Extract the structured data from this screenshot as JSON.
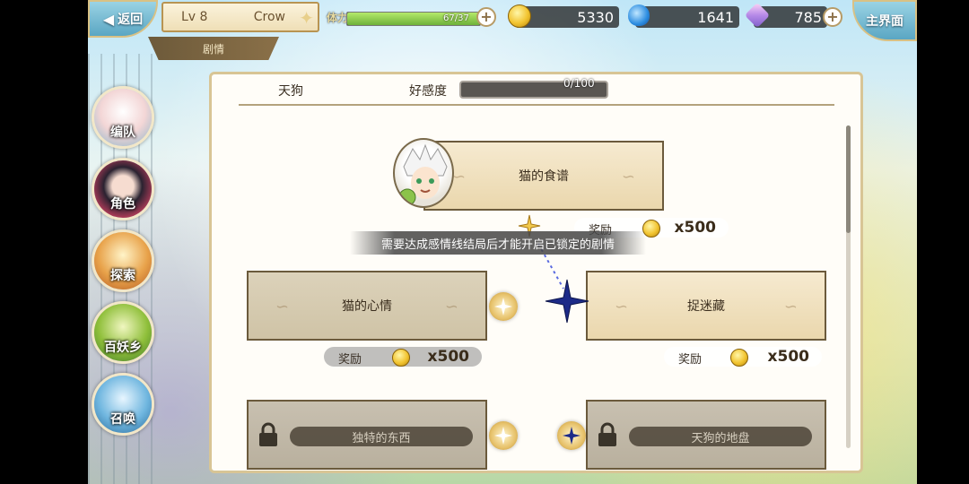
{
  "topbar": {
    "back_label": "返回",
    "level": "Lv 8",
    "player_name": "Crow",
    "plot_tab": "剧情",
    "stamina_label": "体力",
    "stamina_value": "67/37",
    "stamina_fraction": 1.0,
    "gold": "5330",
    "soul": "1641",
    "crystal": "785",
    "home_label": "主界面"
  },
  "sidebar": {
    "items": [
      {
        "label": "编队",
        "icon": "team-icon"
      },
      {
        "label": "角色",
        "icon": "character-icon"
      },
      {
        "label": "探索",
        "icon": "explore-icon"
      },
      {
        "label": "百妖乡",
        "icon": "village-icon"
      },
      {
        "label": "召唤",
        "icon": "summon-icon"
      }
    ]
  },
  "panel": {
    "character_name": "天狗",
    "favor_label": "好感度",
    "favor_value": "0/100",
    "favor_fraction": 0
  },
  "stories": [
    {
      "title": "猫的食谱",
      "reward_label": "奖励",
      "reward_value": "x500",
      "locked": false
    },
    {
      "title": "猫的心情",
      "reward_label": "奖励",
      "reward_value": "x500",
      "locked": false
    },
    {
      "title": "捉迷藏",
      "reward_label": "奖励",
      "reward_value": "x500",
      "locked": false
    },
    {
      "title": "独特的东西",
      "locked": true
    },
    {
      "title": "天狗的地盘",
      "locked": true
    }
  ],
  "tooltip": "需要达成感情线结局后才能开启已锁定的剧情",
  "colors": {
    "panel_border": "#d8c595",
    "card_border": "#6b5a3c",
    "stamina_fill": "#8fcf4f",
    "favor_fill": "#b6e06a"
  }
}
